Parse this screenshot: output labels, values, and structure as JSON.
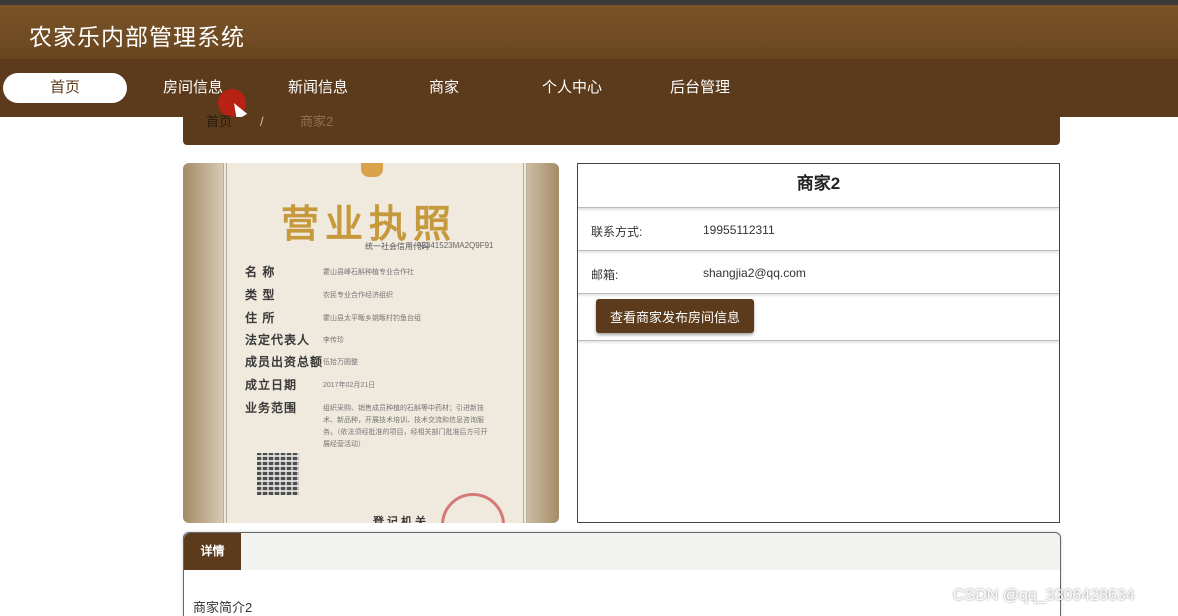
{
  "app": {
    "title": "农家乐内部管理系统"
  },
  "nav": {
    "items": [
      {
        "label": "首页"
      },
      {
        "label": "房间信息"
      },
      {
        "label": "新闻信息"
      },
      {
        "label": "商家"
      },
      {
        "label": "个人中心"
      },
      {
        "label": "后台管理"
      }
    ]
  },
  "breadcrumb": {
    "home": "首页",
    "separator": "/",
    "current": "商家2"
  },
  "license": {
    "title": "营业执照",
    "code_label": "统一社会信用代码",
    "code_value": "93341523MA2Q9F91",
    "fields": [
      {
        "label": "名 称",
        "value": "霍山县峰石斛种植专业合作社"
      },
      {
        "label": "类 型",
        "value": "农民专业合作经济组织"
      },
      {
        "label": "住 所",
        "value": "霍山县太平畈乡姚畈村钓鱼台组"
      },
      {
        "label": "法定代表人",
        "value": "李传珍"
      },
      {
        "label": "成员出资总额",
        "value": "伍拾万圆整"
      },
      {
        "label": "成立日期",
        "value": "2017年02月21日"
      },
      {
        "label": "业务范围",
        "value": ""
      }
    ],
    "scope_text": "组织采购、销售成员种植的石斛等中药材；引进新技术、新品种，开展技术培训、技术交流和信息咨询服务。（依法须经批准的项目，经相关部门批准后方可开展经营活动）",
    "registration": "登记机关"
  },
  "merchant": {
    "name": "商家2",
    "contact_label": "联系方式:",
    "contact_value": "19955112311",
    "email_label": "邮箱:",
    "email_value": "shangjia2@qq.com",
    "view_rooms_button": "查看商家发布房间信息"
  },
  "detail": {
    "tab_label": "详情",
    "intro": "商家简介2"
  },
  "watermark": "CSDN @qq_3306428634",
  "colors": {
    "header": "#6a4620",
    "nav": "#5c3b1c",
    "accent": "#5c3b1c"
  }
}
